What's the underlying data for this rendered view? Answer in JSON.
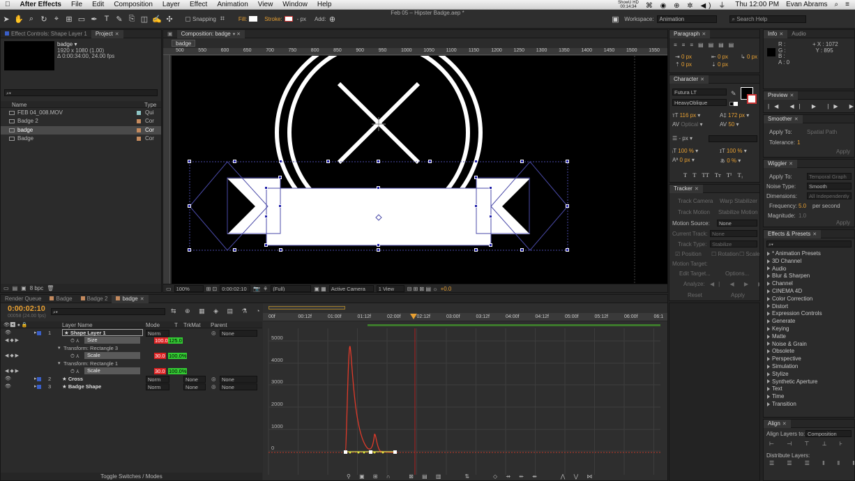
{
  "menubar": {
    "apple": "",
    "app": "After Effects",
    "items": [
      "File",
      "Edit",
      "Composition",
      "Layer",
      "Effect",
      "Animation",
      "View",
      "Window",
      "Help"
    ],
    "clock": "Thu 12:00 PM",
    "user": "Evan Abrams",
    "showhd": "ShowU HD",
    "timer": "00:14:34"
  },
  "window_title": "Feb 05 – Hipster Badge.aep *",
  "toolbar": {
    "snapping": "Snapping",
    "fill": "Fill:",
    "stroke": "Stroke:",
    "stroke_px": "- px",
    "add": "Add:",
    "workspace_label": "Workspace:",
    "workspace": "Animation",
    "search_help": "Search Help"
  },
  "project": {
    "tab_effect_controls": "Effect Controls: Shape Layer 1",
    "tab_project": "Project",
    "comp_name": "badge ▾",
    "comp_size": "1920 x 1080 (1.00)",
    "comp_duration": "Δ 0:00:34:00, 24.00 fps",
    "col_name": "Name",
    "col_type": "Type",
    "items": [
      {
        "name": "FEB 04_008.MOV",
        "type": "Qui",
        "color": "#8ec5c5"
      },
      {
        "name": "Badge 2",
        "type": "Cor",
        "color": "#c48a5e"
      },
      {
        "name": "badge",
        "type": "Cor",
        "color": "#c48a5e"
      },
      {
        "name": "Badge",
        "type": "Cor",
        "color": "#c48a5e"
      }
    ],
    "bpc": "8 bpc"
  },
  "comp": {
    "tab": "Composition: badge",
    "crumb": "badge",
    "ruler": [
      "500",
      "550",
      "600",
      "650",
      "700",
      "750",
      "800",
      "850",
      "900",
      "950",
      "1000",
      "1050",
      "1100",
      "1150",
      "1200",
      "1250",
      "1300",
      "1350",
      "1400",
      "1450",
      "1500",
      "1550"
    ],
    "zoom": "100%",
    "time": "0:00:02:10",
    "quality": "(Full)",
    "camera": "Active Camera",
    "view": "1 View",
    "exposure": "+0.0"
  },
  "timeline": {
    "tabs": [
      "Render Queue",
      "Badge",
      "Badge 2",
      "badge"
    ],
    "timecode": "0:00:02:10",
    "frames": "00058 (24.00 fps)",
    "col_layer": "Layer Name",
    "col_mode": "Mode",
    "col_t": "T",
    "col_trkmat": "TrkMat",
    "col_parent": "Parent",
    "ruler": [
      "00f",
      "00:12f",
      "01:00f",
      "01:12f",
      "02:00f",
      "02:12f",
      "03:00f",
      "03:12f",
      "04:00f",
      "04:12f",
      "05:00f",
      "05:12f",
      "06:00f",
      "06:1"
    ],
    "graph_labels": [
      "5000",
      "4000",
      "3000",
      "2000",
      "1000",
      "0"
    ],
    "toggle": "Toggle Switches / Modes",
    "layers": [
      {
        "num": "1",
        "name": "Shape Layer 1",
        "mode": "Norm",
        "parent": "None"
      },
      {
        "name": "Size",
        "v1": "100.0",
        "v2": "125.0"
      },
      {
        "name": "Transform: Rectangle 3"
      },
      {
        "name": "Scale",
        "v1": "30.0",
        "v2": "100.0%"
      },
      {
        "name": "Transform: Rectangle 1"
      },
      {
        "name": "Scale",
        "v1": "30.0",
        "v2": "100.0%"
      },
      {
        "num": "2",
        "name": "Cross",
        "mode": "Norm",
        "trkmat": "None",
        "parent": "None"
      },
      {
        "num": "3",
        "name": "Badge Shape",
        "mode": "Norm",
        "trkmat": "None",
        "parent": "None"
      }
    ]
  },
  "paragraph": {
    "tab": "Paragraph",
    "values": [
      "0 px",
      "0 px",
      "0 px",
      "0 px",
      "0 px"
    ]
  },
  "character": {
    "tab": "Character",
    "font": "Futura LT",
    "style": "HeavyOblique",
    "size": "116 px",
    "leading": "172 px",
    "kerning": "Optical",
    "tracking": "50",
    "stroke": "- px",
    "vscale": "100 %",
    "hscale": "100 %",
    "baseline": "0 px",
    "tsume": "0 %",
    "tt": [
      "T",
      "T",
      "TT",
      "Tт",
      "T¹",
      "T₁"
    ]
  },
  "tracker": {
    "tab": "Tracker",
    "track_camera": "Track Camera",
    "warp": "Warp Stabilizer",
    "track_motion": "Track Motion",
    "stabilize": "Stabilize Motion",
    "motion_source": "Motion Source:",
    "ms_val": "None",
    "current_track": "Current Track:",
    "ct_val": "None",
    "track_type": "Track Type:",
    "tt_val": "Stabilize",
    "position": "Position",
    "rotation": "Rotation",
    "scale": "Scale",
    "motion_target": "Motion Target:",
    "edit_target": "Edit Target...",
    "options": "Options...",
    "analyze": "Analyze:",
    "reset": "Reset",
    "apply": "Apply"
  },
  "info": {
    "tab_info": "Info",
    "tab_audio": "Audio",
    "r": "R :",
    "g": "G :",
    "b": "B :",
    "a": "A : 0",
    "x": "X : 1072",
    "y": "Y : 895"
  },
  "preview": {
    "tab": "Preview"
  },
  "smoother": {
    "tab": "Smoother",
    "apply_to": "Apply To:",
    "apply_to_val": "Spatial Path",
    "tolerance": "Tolerance:",
    "tol_val": "1",
    "apply": "Apply"
  },
  "wiggler": {
    "tab": "Wiggler",
    "apply_to": "Apply To:",
    "apply_to_val": "Temporal Graph",
    "noise": "Noise Type:",
    "noise_val": "Smooth",
    "dims": "Dimensions:",
    "dims_val": "All Independently",
    "freq": "Frequency:",
    "freq_val": "5.0",
    "per": "per second",
    "mag": "Magnitude:",
    "mag_val": "1.0",
    "apply": "Apply"
  },
  "effects": {
    "tab": "Effects & Presets",
    "items": [
      "* Animation Presets",
      "3D Channel",
      "Audio",
      "Blur & Sharpen",
      "Channel",
      "CINEMA 4D",
      "Color Correction",
      "Distort",
      "Expression Controls",
      "Generate",
      "Keying",
      "Matte",
      "Noise & Grain",
      "Obsolete",
      "Perspective",
      "Simulation",
      "Stylize",
      "Synthetic Aperture",
      "Text",
      "Time",
      "Transition"
    ]
  },
  "align": {
    "tab": "Align",
    "align_to": "Align Layers to:",
    "align_to_val": "Composition",
    "distribute": "Distribute Layers:"
  }
}
